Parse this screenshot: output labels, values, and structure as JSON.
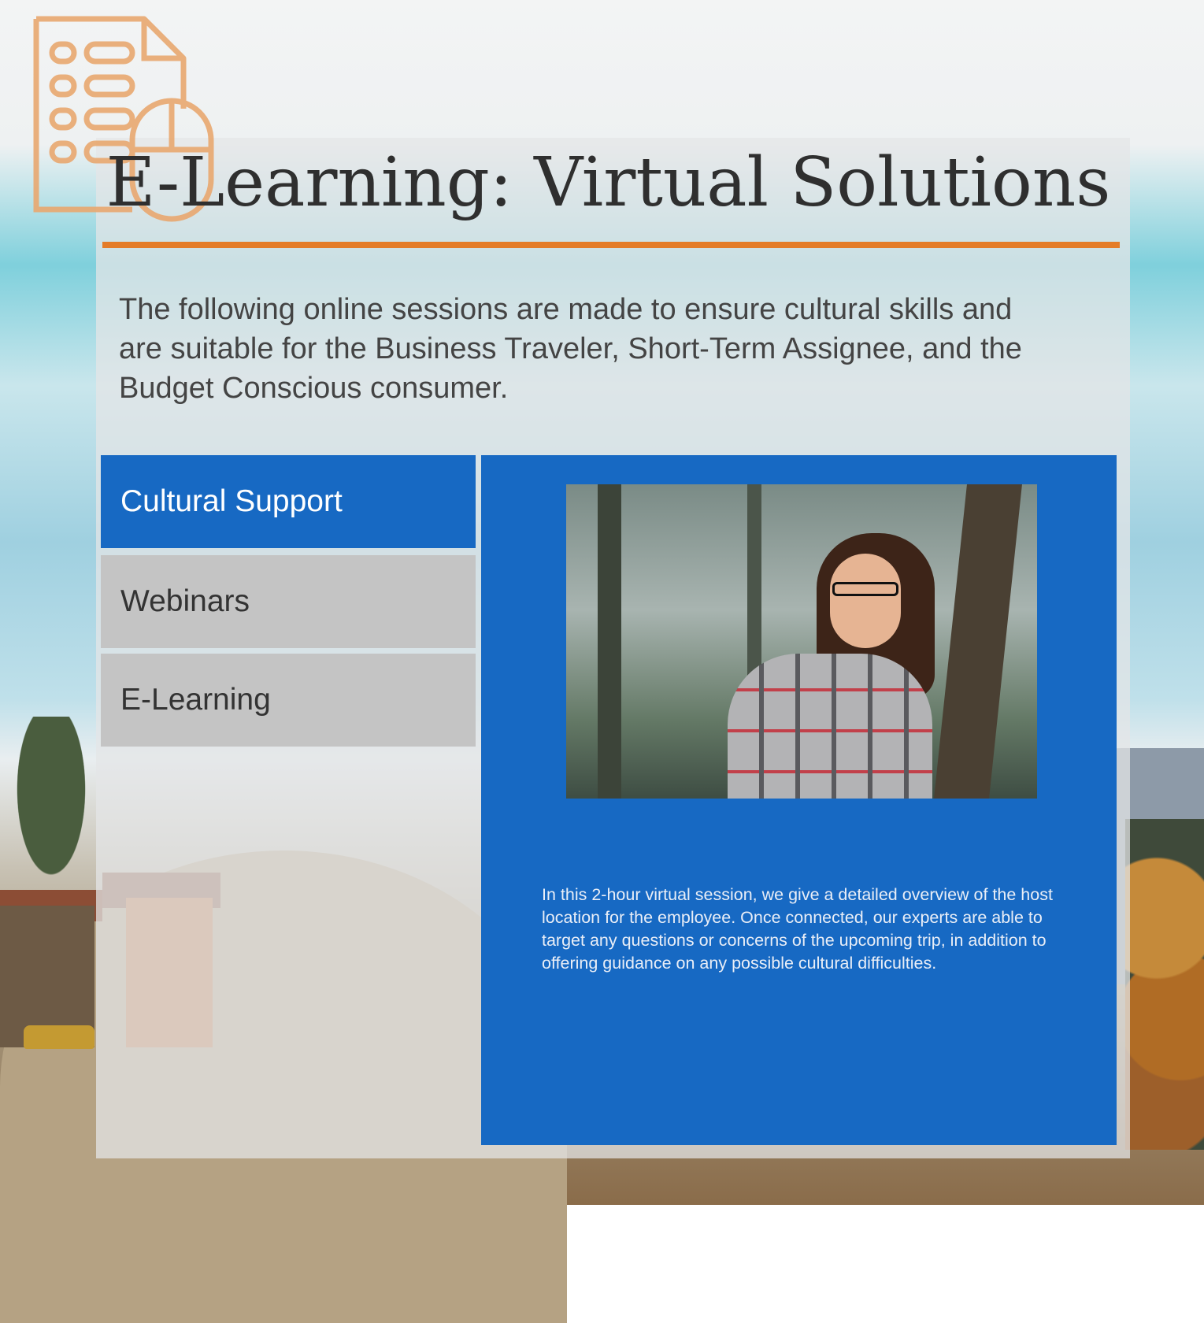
{
  "header": {
    "title": "E-Learning: Virtual Solutions"
  },
  "intro": {
    "text": "The following online sessions are made to ensure cultural skills and are suitable for the Business Traveler, Short-Term Assignee, and the Budget Conscious consumer."
  },
  "tabs": [
    {
      "label": "Cultural Support",
      "active": true
    },
    {
      "label": "Webinars",
      "active": false
    },
    {
      "label": "E-Learning",
      "active": false
    }
  ],
  "content": {
    "description": "In this 2-hour virtual session, we give a detailed overview of the host location for the employee. Once connected, our experts are able to target any questions or concerns of the upcoming trip, in addition to offering guidance on any possible cultural difficulties."
  },
  "icons": {
    "logo": "document-mouse-icon"
  },
  "colors": {
    "accent": "#e47c28",
    "primary_blue": "#1769c3",
    "tab_inactive": "#c4c4c4",
    "logo": "#e9a870"
  }
}
